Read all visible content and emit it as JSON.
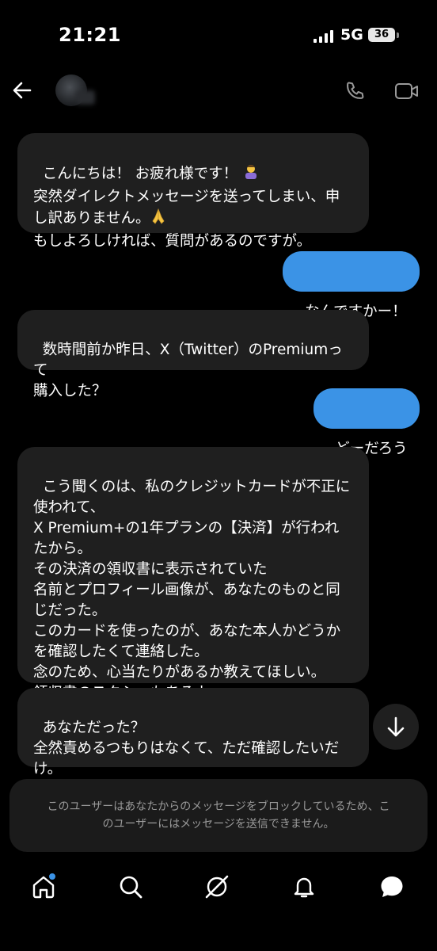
{
  "status_bar": {
    "time": "21:21",
    "network": "5G",
    "battery": "36"
  },
  "header": {
    "contact_name": ""
  },
  "messages": [
    {
      "direction": "incoming",
      "text": "こんにちは！ お疲れ様です！ ",
      "emoji": "person-bowing"
    },
    {
      "direction": "incoming",
      "text": "突然ダイレクトメッセージを送ってしまい、申\nし訳ありません。",
      "emoji": "folded-hands"
    },
    {
      "direction": "incoming",
      "text": "もしよろしければ、質問があるのですが。"
    },
    {
      "direction": "outgoing",
      "text": "なんですかー！"
    },
    {
      "direction": "incoming",
      "text": "数時間前か昨日、X（Twitter）のPremiumって\n購入した？"
    },
    {
      "direction": "outgoing",
      "text": "どーだろう"
    },
    {
      "direction": "incoming",
      "text": "こう聞くのは、私のクレジットカードが不正に\n使われて、\nX Premium+の1年プランの【決済】が行われ\nたから。\nその決済の領収書に表示されていた\n名前とプロフィール画像が、あなたのものと同\nじだった。\nこのカードを使ったのが、あなた本人かどうか\nを確認したくて連絡した。\n念のため、心当たりがあるか教えてほしい。\n領収書のスクショもあるよ。"
    },
    {
      "direction": "incoming",
      "text": "あなただった？\n全然責めるつもりはなくて、ただ確認したいだ\nけ。"
    }
  ],
  "blocked_notice": "このユーザーはあなたからのメッセージをブロックしているため、こ\nのユーザーにはメッセージを送信できません。",
  "colors": {
    "background": "#000000",
    "incoming_bubble": "#1f1f1f",
    "outgoing_bubble": "#3b93e6",
    "notification_dot": "#3b93e6"
  },
  "icons": {
    "header": [
      "back-arrow-icon",
      "phone-icon",
      "video-camera-icon"
    ],
    "nav": [
      "home-icon",
      "search-icon",
      "grok-icon",
      "bell-icon",
      "messages-icon"
    ],
    "scroll": "arrow-down-icon"
  }
}
